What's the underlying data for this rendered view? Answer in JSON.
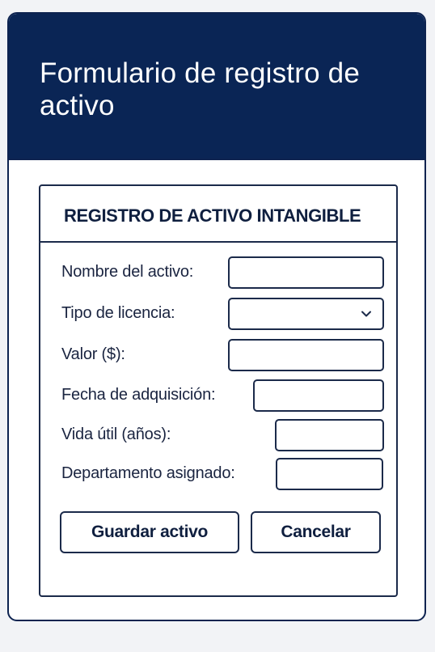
{
  "header": {
    "title": "Formulario de registro de activo"
  },
  "panel": {
    "title": "REGISTRO DE ACTIVO INTANGIBLE"
  },
  "fields": {
    "nombre": {
      "label": "Nombre del activo:",
      "value": ""
    },
    "licencia": {
      "label": "Tipo de licencia:",
      "value": "",
      "icon": "chevron-down-icon"
    },
    "valor": {
      "label": "Valor ($):",
      "value": ""
    },
    "fecha": {
      "label": "Fecha de adquisición:",
      "value": ""
    },
    "vida": {
      "label": "Vida útil (años):",
      "value": ""
    },
    "departamento": {
      "label": "Departamento asignado:",
      "value": ""
    }
  },
  "buttons": {
    "save_label": "Guardar activo",
    "cancel_label": "Cancelar"
  },
  "colors": {
    "header_bg": "#0a2555",
    "border": "#1b2a4a",
    "page_bg": "#f2f3f6"
  }
}
